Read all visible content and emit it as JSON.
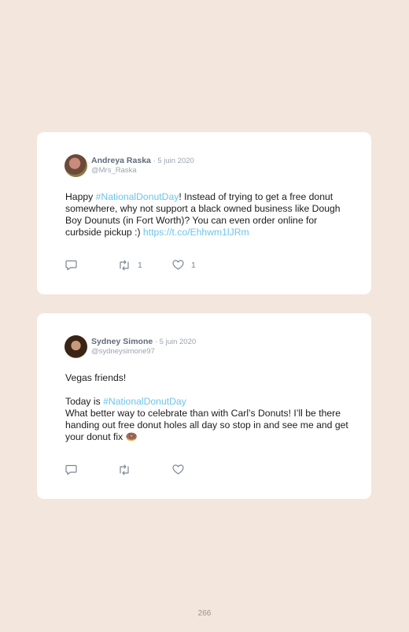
{
  "tweets": [
    {
      "author": "Andreya Raska",
      "date": "5 juin 2020",
      "handle": "@Mrs_Raska",
      "text_parts": [
        "Happy ",
        "#NationalDonutDay",
        "! Instead of trying to get a free donut somewhere, why not support a black owned business like Dough Boy Dounuts (in Fort Worth)? You can even order online for curbside pickup :) ",
        "https://t.co/Ehhwm1lJRm"
      ],
      "retweets": "1",
      "likes": "1"
    },
    {
      "author": "Sydney Simone",
      "date": "5 juin 2020",
      "handle": "@sydneysimone97",
      "line1": "Vegas friends!",
      "line2_prefix": "Today is ",
      "line2_tag": "#NationalDonutDay",
      "line3": "What better way to celebrate than with Carl’s Donuts! I’ll be there handing out free donut holes all day so stop in and see me and get your donut fix 🍩",
      "retweets": "",
      "likes": ""
    }
  ],
  "separator": " · ",
  "page_number": "266",
  "colors": {
    "background": "#f3e6dc",
    "card": "#ffffff",
    "link": "#6cc4ea",
    "name": "#5f6a7a",
    "muted": "#9aa4b0"
  },
  "icons": [
    "reply-icon",
    "retweet-icon",
    "heart-icon"
  ]
}
